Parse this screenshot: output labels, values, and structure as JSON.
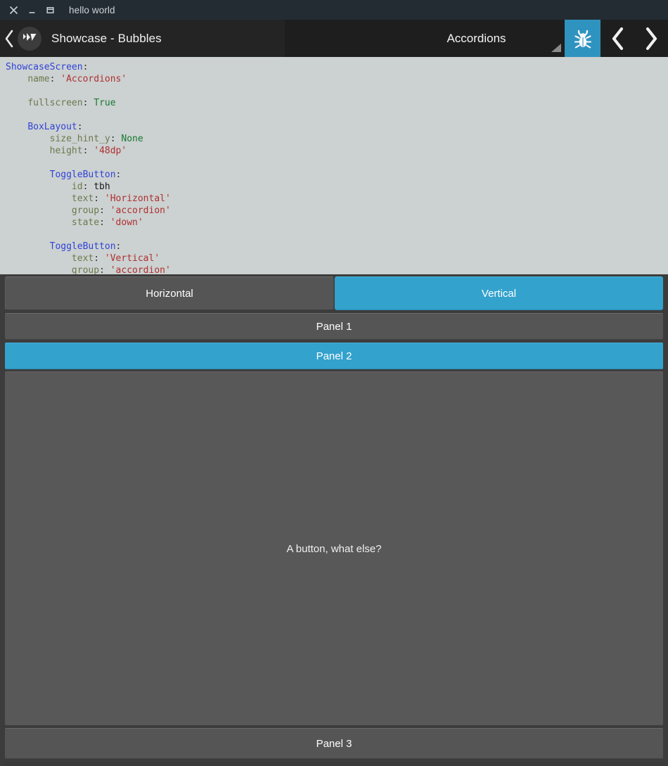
{
  "window": {
    "title": "hello world",
    "controls": [
      {
        "name": "close",
        "glyph": "close-icon"
      },
      {
        "name": "minimize",
        "glyph": "minimize-icon"
      },
      {
        "name": "maximize",
        "glyph": "maximize-icon"
      }
    ]
  },
  "actionbar": {
    "back_label": "back-chevron",
    "app_title": "Showcase - Bubbles",
    "screen_title": "Accordions",
    "logo_name": "kivy-logo-icon",
    "bug_button_label": "bug-icon",
    "prev_label": "previous-chevron",
    "next_label": "next-chevron",
    "accent_color": "#2f93bf"
  },
  "code": {
    "language": "kv",
    "lines": [
      [
        {
          "t": "ShowcaseScreen",
          "c": "k-cls"
        },
        {
          "t": ":",
          "c": "k-pun"
        }
      ],
      [
        {
          "t": "    "
        },
        {
          "t": "name",
          "c": "k-prop"
        },
        {
          "t": ": ",
          "c": "k-pun"
        },
        {
          "t": "'Accordions'",
          "c": "k-str"
        }
      ],
      [
        {
          "t": ""
        }
      ],
      [
        {
          "t": "    "
        },
        {
          "t": "fullscreen",
          "c": "k-prop"
        },
        {
          "t": ": ",
          "c": "k-pun"
        },
        {
          "t": "True",
          "c": "k-kw"
        }
      ],
      [
        {
          "t": ""
        }
      ],
      [
        {
          "t": "    "
        },
        {
          "t": "BoxLayout",
          "c": "k-cls"
        },
        {
          "t": ":",
          "c": "k-pun"
        }
      ],
      [
        {
          "t": "        "
        },
        {
          "t": "size_hint_y",
          "c": "k-prop"
        },
        {
          "t": ": ",
          "c": "k-pun"
        },
        {
          "t": "None",
          "c": "k-kw"
        }
      ],
      [
        {
          "t": "        "
        },
        {
          "t": "height",
          "c": "k-prop"
        },
        {
          "t": ": ",
          "c": "k-pun"
        },
        {
          "t": "'48dp'",
          "c": "k-str"
        }
      ],
      [
        {
          "t": ""
        }
      ],
      [
        {
          "t": "        "
        },
        {
          "t": "ToggleButton",
          "c": "k-cls"
        },
        {
          "t": ":",
          "c": "k-pun"
        }
      ],
      [
        {
          "t": "            "
        },
        {
          "t": "id",
          "c": "k-prop"
        },
        {
          "t": ": ",
          "c": "k-pun"
        },
        {
          "t": "tbh",
          "c": "k-pln"
        }
      ],
      [
        {
          "t": "            "
        },
        {
          "t": "text",
          "c": "k-prop"
        },
        {
          "t": ": ",
          "c": "k-pun"
        },
        {
          "t": "'Horizontal'",
          "c": "k-str"
        }
      ],
      [
        {
          "t": "            "
        },
        {
          "t": "group",
          "c": "k-prop"
        },
        {
          "t": ": ",
          "c": "k-pun"
        },
        {
          "t": "'accordion'",
          "c": "k-str"
        }
      ],
      [
        {
          "t": "            "
        },
        {
          "t": "state",
          "c": "k-prop"
        },
        {
          "t": ": ",
          "c": "k-pun"
        },
        {
          "t": "'down'",
          "c": "k-str"
        }
      ],
      [
        {
          "t": ""
        }
      ],
      [
        {
          "t": "        "
        },
        {
          "t": "ToggleButton",
          "c": "k-cls"
        },
        {
          "t": ":",
          "c": "k-pun"
        }
      ],
      [
        {
          "t": "            "
        },
        {
          "t": "text",
          "c": "k-prop"
        },
        {
          "t": ": ",
          "c": "k-pun"
        },
        {
          "t": "'Vertical'",
          "c": "k-str"
        }
      ],
      [
        {
          "t": "            "
        },
        {
          "t": "group",
          "c": "k-prop"
        },
        {
          "t": ": ",
          "c": "k-pun"
        },
        {
          "t": "'accordion'",
          "c": "k-str"
        }
      ]
    ]
  },
  "showcase": {
    "toggles": [
      {
        "label": "Horizontal",
        "state": "normal"
      },
      {
        "label": "Vertical",
        "state": "down"
      }
    ],
    "accordion": [
      {
        "label": "Panel 1",
        "expanded": false
      },
      {
        "label": "Panel 2",
        "expanded": true,
        "content": "A button, what else?"
      },
      {
        "label": "Panel 3",
        "expanded": false
      }
    ],
    "expanded_content_label": "A button, what else?",
    "accent_color": "#33a2cd",
    "surface_color": "#555555"
  }
}
